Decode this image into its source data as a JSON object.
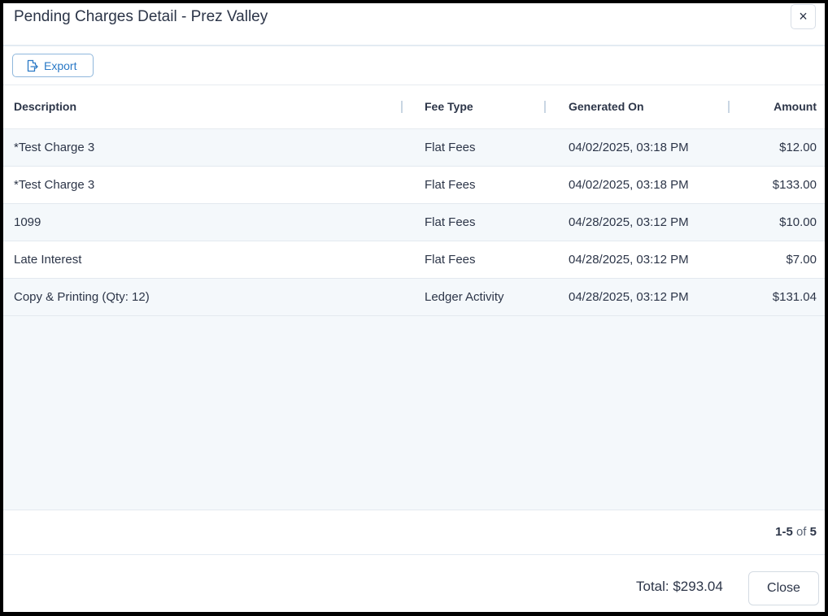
{
  "dialog": {
    "title": "Pending Charges Detail - Prez Valley",
    "close_icon": "×"
  },
  "toolbar": {
    "export_label": "Export",
    "export_icon": "export-file-icon"
  },
  "table": {
    "columns": [
      "Description",
      "Fee Type",
      "Generated On",
      "Amount"
    ],
    "rows": [
      {
        "description": "*Test Charge 3",
        "fee_type": "Flat Fees",
        "generated_on": "04/02/2025, 03:18 PM",
        "amount": "$12.00"
      },
      {
        "description": "*Test Charge 3",
        "fee_type": "Flat Fees",
        "generated_on": "04/02/2025, 03:18 PM",
        "amount": "$133.00"
      },
      {
        "description": "1099",
        "fee_type": "Flat Fees",
        "generated_on": "04/28/2025, 03:12 PM",
        "amount": "$10.00"
      },
      {
        "description": "Late Interest",
        "fee_type": "Flat Fees",
        "generated_on": "04/28/2025, 03:12 PM",
        "amount": "$7.00"
      },
      {
        "description": "Copy & Printing (Qty: 12)",
        "fee_type": "Ledger Activity",
        "generated_on": "04/28/2025, 03:12 PM",
        "amount": "$131.04"
      }
    ]
  },
  "pagination": {
    "range": "1-5",
    "of_label": "of",
    "total": "5"
  },
  "footer": {
    "total_label": "Total: $293.04",
    "close_label": "Close"
  },
  "colors": {
    "accent": "#2a79c6",
    "row_alt": "#f4f8fb"
  }
}
